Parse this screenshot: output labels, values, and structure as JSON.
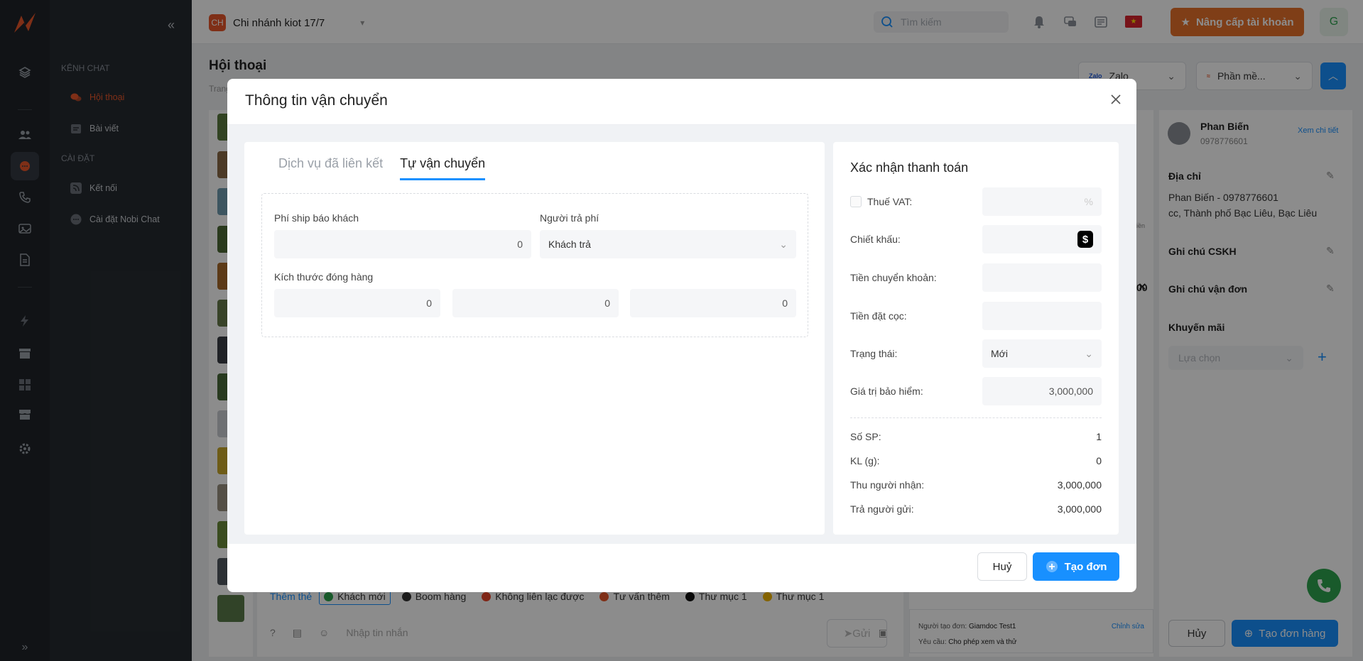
{
  "header": {
    "branch_badge": "CH",
    "branch_name": "Chi nhánh kiot 17/7",
    "search_placeholder": "Tìm kiếm",
    "upgrade_label": "Nâng cấp tài khoản",
    "user_initial": "G"
  },
  "sidebar": {
    "section_chat": "KÊNH CHAT",
    "section_settings": "CÀI ĐẶT",
    "items": [
      {
        "label": "Hội thoại"
      },
      {
        "label": "Bài viết"
      },
      {
        "label": "Kết nối"
      },
      {
        "label": "Cài đặt Nobi Chat"
      }
    ]
  },
  "page": {
    "title": "Hội thoại",
    "breadcrumb": "Trang",
    "channel_select": "Zalo",
    "channel_brand": "Zalo",
    "software_select": "Phần mề..."
  },
  "chat": {
    "add_tag": "Thêm thẻ",
    "tags": [
      {
        "label": "Khách mới",
        "color": "#2ea44f"
      },
      {
        "label": "Boom hàng",
        "color": "#333333"
      },
      {
        "label": "Không liên lạc được",
        "color": "#e8452a"
      },
      {
        "label": "Tư vấn thêm",
        "color": "#e8562a"
      },
      {
        "label": "Thư mục 1",
        "color": "#111111"
      },
      {
        "label": "Thư mục 1",
        "color": "#f0b400"
      }
    ],
    "message_placeholder": "Nhập tin nhắn",
    "send_label": "Gửi"
  },
  "order_panel": {
    "created_by_label": "Người tạo đơn:",
    "created_by_value": "Giamdoc Test1",
    "edit_label": "Chỉnh sửa",
    "request_label": "Yêu cầu:",
    "request_value": "Cho phép xem và thử",
    "peek_label": "iền",
    "peek_value": "00"
  },
  "customer": {
    "name": "Phan Biến",
    "phone": "0978776601",
    "view_detail": "Xem chi tiết",
    "address_label": "Địa chỉ",
    "address_line1": "Phan Biến - 0978776601",
    "address_line2": "cc, Thành phố Bạc Liêu, Bạc Liêu",
    "note_cskh_label": "Ghi chú CSKH",
    "note_shipping_label": "Ghi chú vận đơn",
    "promotion_label": "Khuyến mãi",
    "promotion_placeholder": "Lựa chọn",
    "cancel_label": "Hủy",
    "create_order_label": "Tạo đơn hàng"
  },
  "modal": {
    "title": "Thông tin vận chuyển",
    "tabs": [
      {
        "label": "Dịch vụ đã liên kết",
        "active": false
      },
      {
        "label": "Tự vận chuyển",
        "active": true
      }
    ],
    "ship_fee_label": "Phí ship báo khách",
    "ship_fee_value": "0",
    "payer_label": "Người trả phí",
    "payer_value": "Khách trả",
    "package_size_label": "Kích thước đóng hàng",
    "size_values": [
      "0",
      "0",
      "0"
    ],
    "payment": {
      "title": "Xác nhận thanh toán",
      "vat_label": "Thuế VAT:",
      "vat_unit": "%",
      "discount_label": "Chiết khấu:",
      "discount_unit": "$",
      "transfer_label": "Tiền chuyển khoản:",
      "deposit_label": "Tiền đặt cọc:",
      "status_label": "Trạng thái:",
      "status_value": "Mới",
      "insurance_label": "Giá trị bảo hiểm:",
      "insurance_value": "3,000,000",
      "summary": [
        {
          "label": "Số SP:",
          "value": "1"
        },
        {
          "label": "KL (g):",
          "value": "0"
        },
        {
          "label": "Thu người nhận:",
          "value": "3,000,000"
        },
        {
          "label": "Trả người gửi:",
          "value": "3,000,000"
        }
      ]
    },
    "cancel_label": "Huỷ",
    "submit_label": "Tạo đơn"
  },
  "colors": {
    "accent": "#1890ff",
    "brand": "#e8562a",
    "upgrade": "#e8712a"
  }
}
